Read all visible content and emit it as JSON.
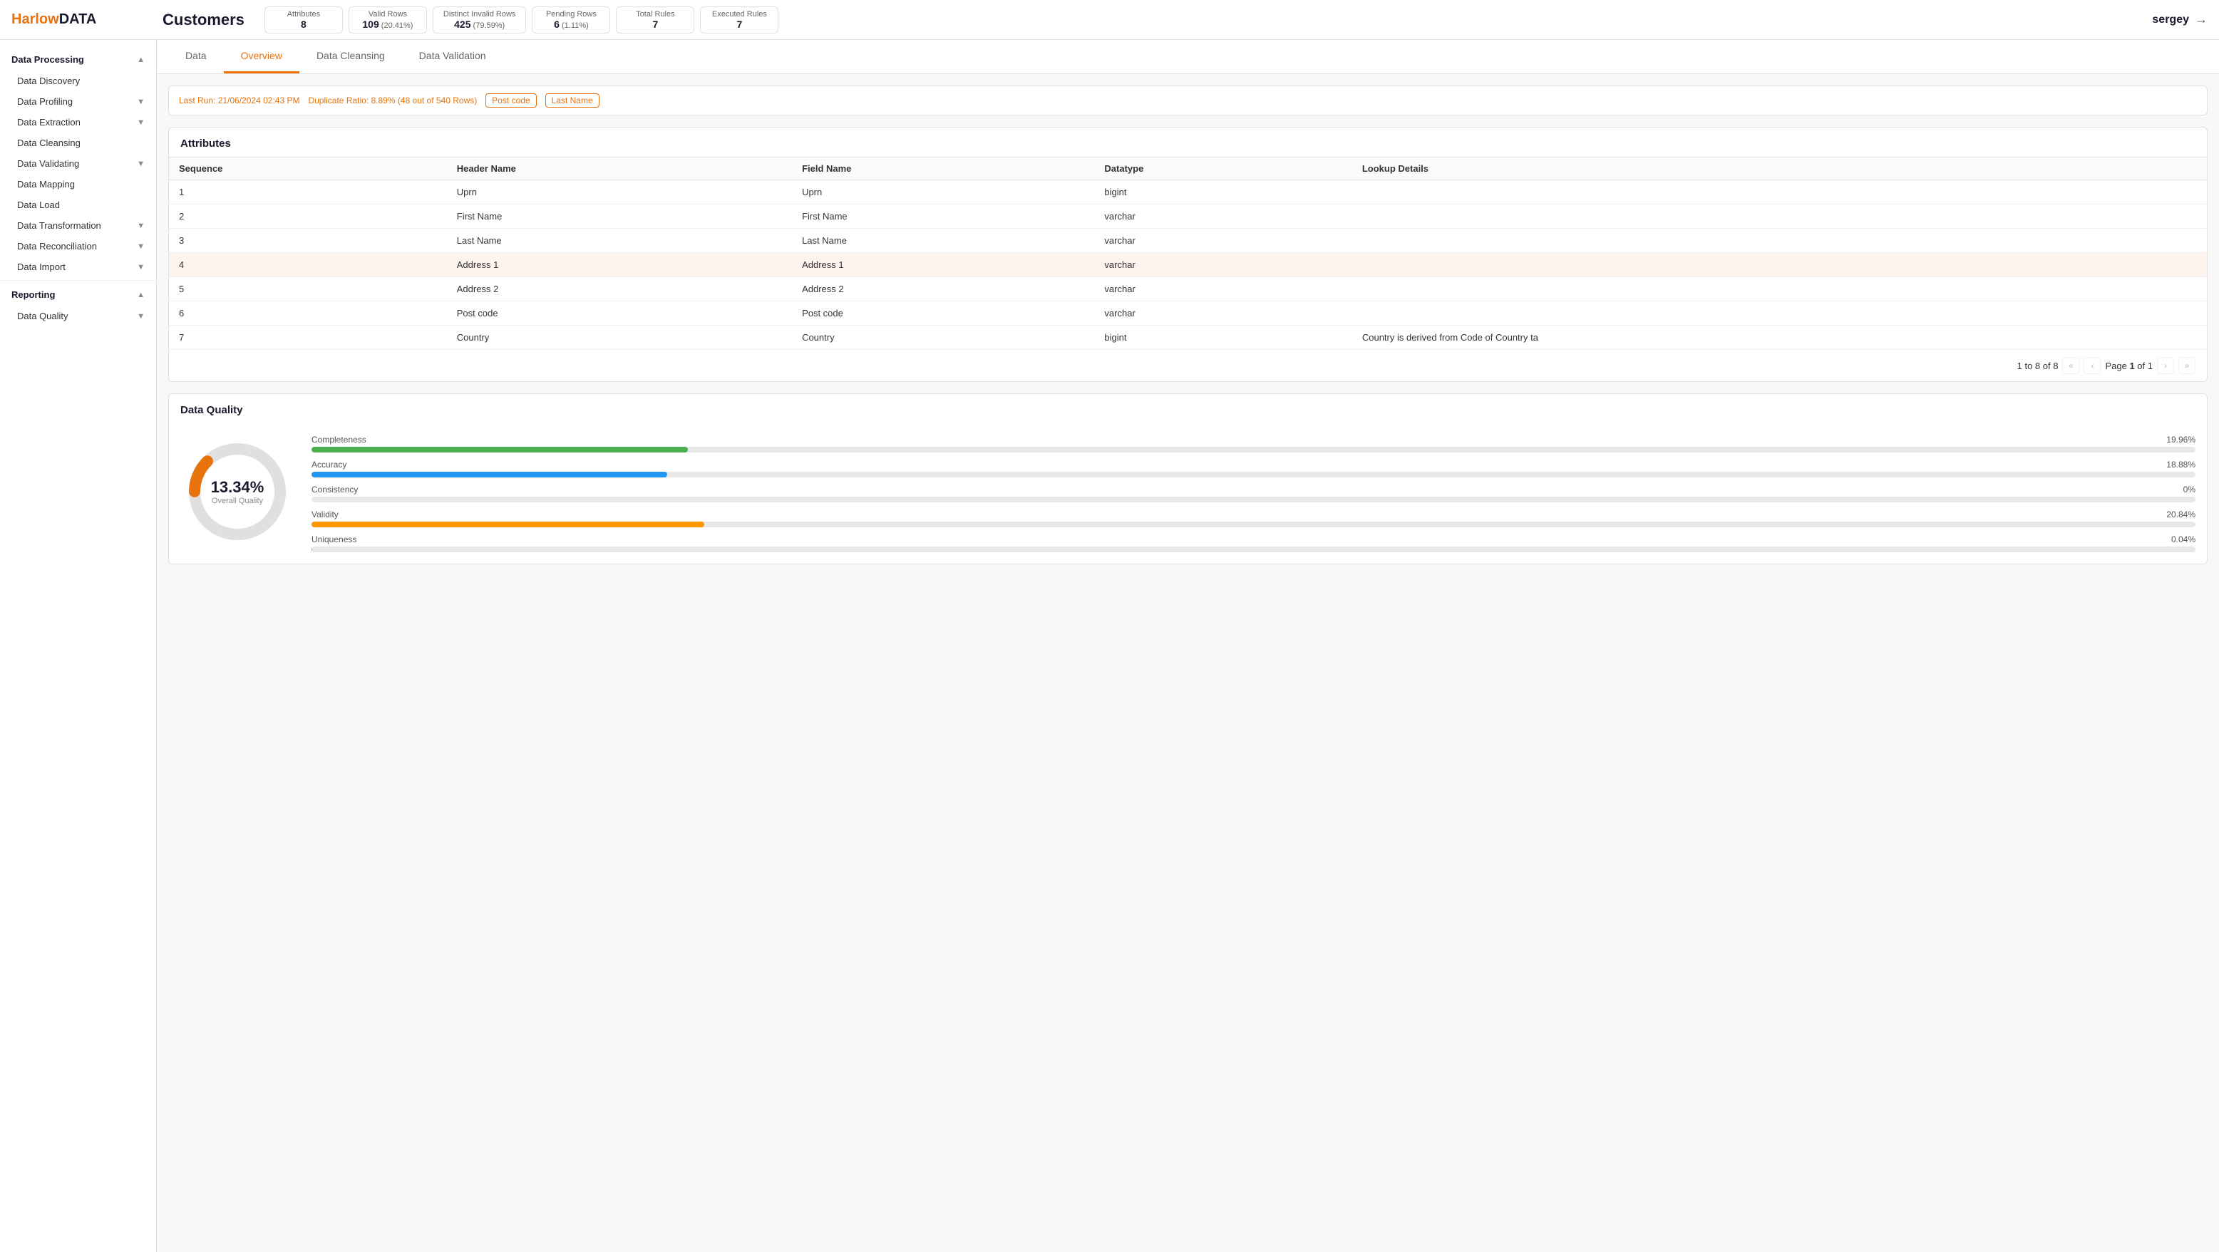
{
  "logo": {
    "harlow": "Harlow",
    "data": "DATA"
  },
  "header": {
    "title": "Customers",
    "stats": [
      {
        "label": "Attributes",
        "value": "8",
        "sub": ""
      },
      {
        "label": "Valid Rows",
        "value": "109",
        "sub": " (20.41%)"
      },
      {
        "label": "Distinct Invalid Rows",
        "value": "425",
        "sub": " (79.59%)"
      },
      {
        "label": "Pending Rows",
        "value": "6",
        "sub": " (1.11%)"
      },
      {
        "label": "Total Rules",
        "value": "7",
        "sub": ""
      },
      {
        "label": "Executed Rules",
        "value": "7",
        "sub": ""
      }
    ],
    "user": "sergey"
  },
  "tabs": [
    {
      "label": "Data",
      "active": false
    },
    {
      "label": "Overview",
      "active": true
    },
    {
      "label": "Data Cleansing",
      "active": false
    },
    {
      "label": "Data Validation",
      "active": false
    }
  ],
  "sidebar": {
    "sections": [
      {
        "label": "Data Processing",
        "expanded": true,
        "items": [
          {
            "label": "Data Discovery",
            "hasChevron": false
          },
          {
            "label": "Data Profiling",
            "hasChevron": true
          },
          {
            "label": "Data Extraction",
            "hasChevron": true
          },
          {
            "label": "Data Cleansing",
            "hasChevron": false
          },
          {
            "label": "Data Validating",
            "hasChevron": true
          },
          {
            "label": "Data Mapping",
            "hasChevron": false
          },
          {
            "label": "Data Load",
            "hasChevron": false
          },
          {
            "label": "Data Transformation",
            "hasChevron": true
          },
          {
            "label": "Data Reconciliation",
            "hasChevron": true
          },
          {
            "label": "Data Import",
            "hasChevron": true
          }
        ]
      },
      {
        "label": "Reporting",
        "expanded": true,
        "items": [
          {
            "label": "Data Quality",
            "hasChevron": true
          }
        ]
      }
    ]
  },
  "info_bar": {
    "last_run": "Last Run: 21/06/2024 02:43 PM",
    "duplicate_ratio": "Duplicate Ratio: 8.89% (48 out of 540 Rows)",
    "tags": [
      "Post code",
      "Last Name"
    ]
  },
  "attributes_section": {
    "title": "Attributes",
    "columns": [
      "Sequence",
      "Header Name",
      "Field Name",
      "Datatype",
      "Lookup Details"
    ],
    "rows": [
      {
        "seq": "1",
        "header": "Uprn",
        "field": "Uprn",
        "dtype": "bigint",
        "lookup": "",
        "highlighted": false
      },
      {
        "seq": "2",
        "header": "First Name",
        "field": "First Name",
        "dtype": "varchar",
        "lookup": "",
        "highlighted": false
      },
      {
        "seq": "3",
        "header": "Last Name",
        "field": "Last Name",
        "dtype": "varchar",
        "lookup": "",
        "highlighted": false
      },
      {
        "seq": "4",
        "header": "Address 1",
        "field": "Address 1",
        "dtype": "varchar",
        "lookup": "",
        "highlighted": true
      },
      {
        "seq": "5",
        "header": "Address 2",
        "field": "Address 2",
        "dtype": "varchar",
        "lookup": "",
        "highlighted": false
      },
      {
        "seq": "6",
        "header": "Post code",
        "field": "Post code",
        "dtype": "varchar",
        "lookup": "",
        "highlighted": false
      },
      {
        "seq": "7",
        "header": "Country",
        "field": "Country",
        "dtype": "bigint",
        "lookup": "Country is derived from Code of Country ta",
        "highlighted": false
      }
    ],
    "pagination": {
      "text": "1 to 8 of 8",
      "page_label": "Page",
      "current": "1",
      "of": "of",
      "total": "1"
    }
  },
  "data_quality": {
    "title": "Data Quality",
    "overall_pct": "13.34%",
    "overall_label": "Overall Quality",
    "bars": [
      {
        "label": "Completeness",
        "pct": 19.96,
        "pct_label": "19.96%",
        "color": "#4caf50"
      },
      {
        "label": "Accuracy",
        "pct": 18.88,
        "pct_label": "18.88%",
        "color": "#2196f3"
      },
      {
        "label": "Consistency",
        "pct": 0,
        "pct_label": "0%",
        "color": "#9e9e9e"
      },
      {
        "label": "Validity",
        "pct": 20.84,
        "pct_label": "20.84%",
        "color": "#ff9800"
      },
      {
        "label": "Uniqueness",
        "pct": 0.04,
        "pct_label": "0.04%",
        "color": "#9e9e9e"
      }
    ],
    "donut": {
      "pct": 13.34,
      "stroke_color": "#e8720c",
      "bg_color": "#e0e0e0"
    }
  }
}
